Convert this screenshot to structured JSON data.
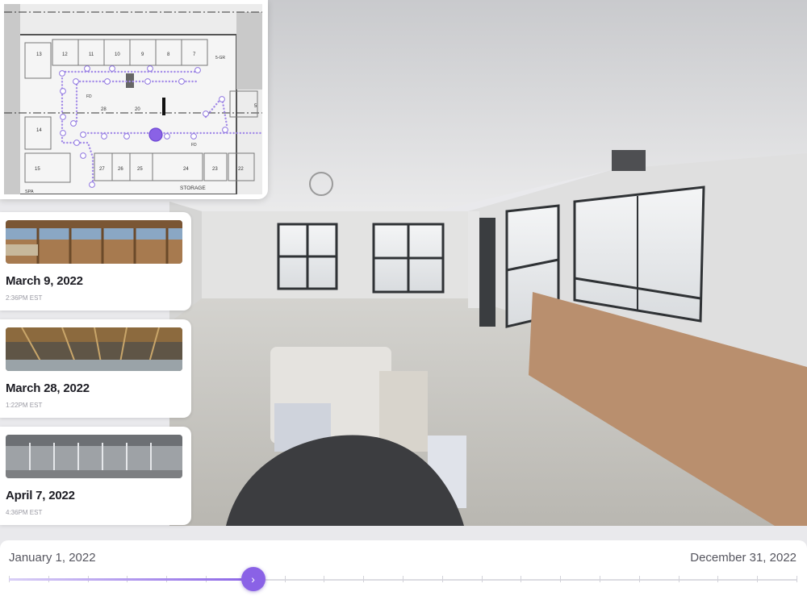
{
  "floorplan": {
    "room_numbers": [
      "13",
      "12",
      "11",
      "10",
      "9",
      "8",
      "7",
      "28",
      "20",
      "14",
      "27",
      "26",
      "25",
      "24",
      "23",
      "22",
      "15",
      "5"
    ],
    "labels": [
      "STORAGE",
      "SPA",
      "FD",
      "FD"
    ],
    "stair_label": "5-GR"
  },
  "captures": [
    {
      "date": "March 9, 2022",
      "time": "2:36PM EST"
    },
    {
      "date": "March 28, 2022",
      "time": "1:22PM EST"
    },
    {
      "date": "April 7, 2022",
      "time": "4:36PM EST"
    }
  ],
  "timeline": {
    "start_label": "January 1, 2022",
    "end_label": "December 31, 2022",
    "progress": 0.31,
    "handle_glyph": "›"
  },
  "colors": {
    "accent": "#8a62e6",
    "path_dot": "#a38be8",
    "card_bg": "#ffffff"
  }
}
